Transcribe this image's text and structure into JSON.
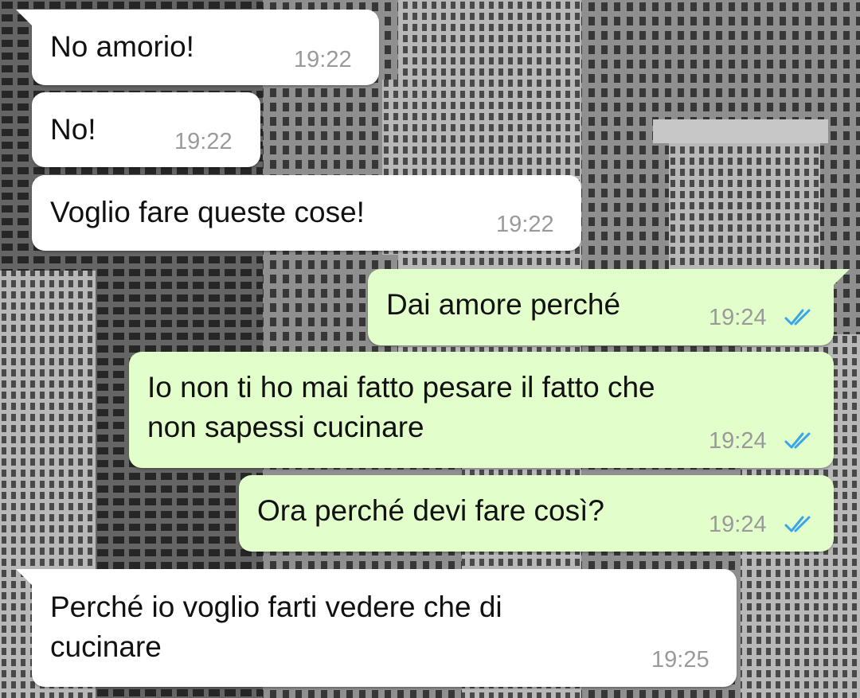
{
  "colors": {
    "incoming_bubble": "#ffffff",
    "outgoing_bubble": "#e2fecb",
    "timestamp": "#9a9a9a",
    "read_ticks": "#3aa5e8"
  },
  "messages": [
    {
      "direction": "in",
      "text": "No amorio!",
      "time": "19:22"
    },
    {
      "direction": "in",
      "text": "No!",
      "time": "19:22"
    },
    {
      "direction": "in",
      "text": "Voglio fare queste cose!",
      "time": "19:22"
    },
    {
      "direction": "out",
      "text": "Dai amore perché",
      "time": "19:24",
      "status_icon": "double-check-icon"
    },
    {
      "direction": "out",
      "text_lines": [
        "Io non ti ho mai fatto pesare il fatto che",
        "non sapessi cucinare"
      ],
      "time": "19:24",
      "status_icon": "double-check-icon"
    },
    {
      "direction": "out",
      "text": "Ora perché devi fare così?",
      "time": "19:24",
      "status_icon": "double-check-icon"
    },
    {
      "direction": "in",
      "text_lines": [
        "Perché io voglio farti vedere che di",
        "cucinare"
      ],
      "time": "19:25"
    }
  ]
}
